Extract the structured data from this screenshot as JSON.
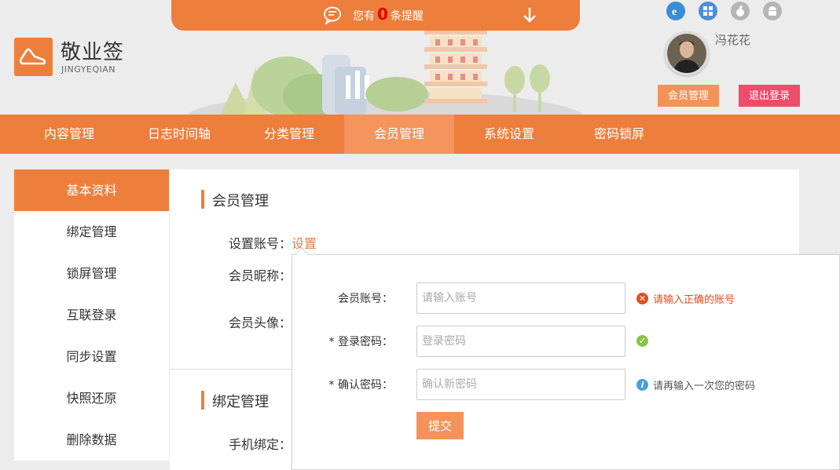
{
  "notice": {
    "prefix": "您有",
    "count": "0",
    "suffix": "条提醒"
  },
  "brand": {
    "name": "敬业签",
    "sub": "JINGYEQIAN"
  },
  "user": {
    "name": "冯花花",
    "member_button": "会员管理",
    "logout_button": "退出登录"
  },
  "platforms": [
    "ie-icon",
    "windows-icon",
    "apple-icon",
    "android-icon"
  ],
  "nav": {
    "items": [
      "内容管理",
      "日志时间轴",
      "分类管理",
      "会员管理",
      "系统设置",
      "密码锁屏"
    ],
    "active": "会员管理"
  },
  "sidebar": {
    "items": [
      "基本资料",
      "绑定管理",
      "锁屏管理",
      "互联登录",
      "同步设置",
      "快照还原",
      "删除数据"
    ],
    "active": "基本资料"
  },
  "main": {
    "section1_title": "会员管理",
    "account_label": "设置账号：",
    "account_link": "设置",
    "nickname_label": "会员昵称：",
    "avatar_label": "会员头像：",
    "section2_title": "绑定管理",
    "phone_label": "手机绑定："
  },
  "popup": {
    "account_label": "会员账号：",
    "account_placeholder": "请输入账号",
    "account_error": "请输入正确的账号",
    "password_label": "* 登录密码：",
    "password_placeholder": "登录密码",
    "confirm_label": "* 确认密码：",
    "confirm_placeholder": "确认新密码",
    "confirm_hint": "请再输入一次您的密码",
    "submit": "提交"
  },
  "colors": {
    "accent": "#ee7e3c",
    "accent_light": "#f3935a",
    "logout": "#ee4c6b",
    "error": "#e64c1e",
    "success": "#8bc34a",
    "info": "#4a9fd8"
  }
}
